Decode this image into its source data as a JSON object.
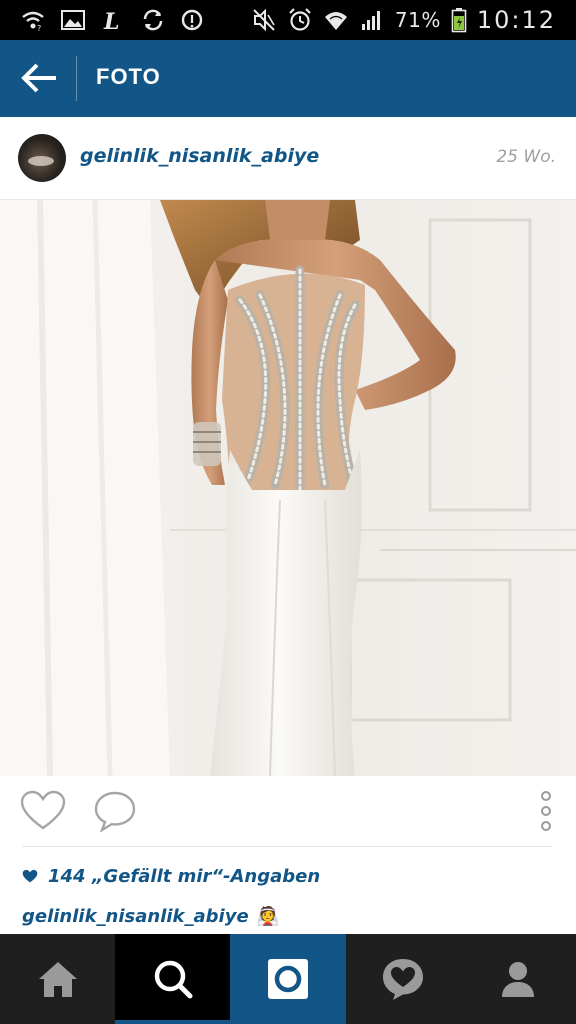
{
  "status_bar": {
    "battery_percent": "71%",
    "time": "10:12",
    "left_icons": [
      "wifi-icon",
      "gallery-icon",
      "lastpass-icon",
      "sync-icon",
      "voicemail-icon"
    ],
    "right_icons": [
      "mute-icon",
      "alarm-icon",
      "wifi-signal-icon",
      "cell-signal-icon",
      "battery-icon"
    ]
  },
  "action_bar": {
    "title": "FOTO",
    "back_icon": "arrow-back-icon",
    "color": "#125688"
  },
  "post": {
    "username": "gelinlik_nisanlik_abiye",
    "time_ago": "25 Wo.",
    "likes_text": "144 „Gefällt mir“-Angaben",
    "caption_user": "gelinlik_nisanlik_abiye",
    "caption_text": "👰"
  },
  "bottom_nav": [
    {
      "name": "home",
      "icon": "home-icon"
    },
    {
      "name": "search",
      "icon": "search-icon",
      "active": true
    },
    {
      "name": "camera",
      "icon": "camera-icon"
    },
    {
      "name": "activity",
      "icon": "activity-heart-icon"
    },
    {
      "name": "profile",
      "icon": "profile-icon"
    }
  ],
  "colors": {
    "brand_blue": "#125688",
    "nav_bg": "#1f1f1f",
    "status_bg": "#000000"
  }
}
